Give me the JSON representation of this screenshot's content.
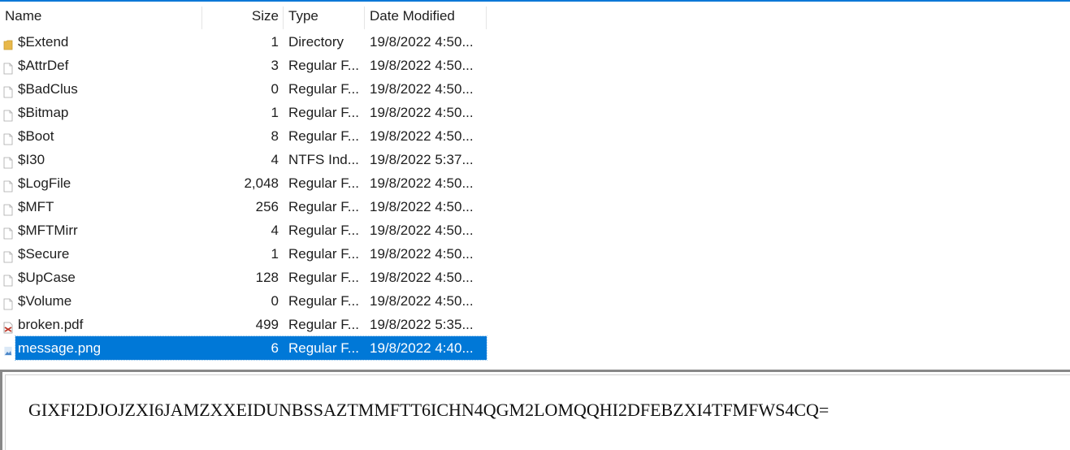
{
  "columns": {
    "name": "Name",
    "size": "Size",
    "type": "Type",
    "date": "Date Modified"
  },
  "files": [
    {
      "name": "$Extend",
      "size": "1",
      "type": "Directory",
      "date": "19/8/2022 4:50...",
      "icon": "folder-icon"
    },
    {
      "name": "$AttrDef",
      "size": "3",
      "type": "Regular F...",
      "date": "19/8/2022 4:50...",
      "icon": "file-icon"
    },
    {
      "name": "$BadClus",
      "size": "0",
      "type": "Regular F...",
      "date": "19/8/2022 4:50...",
      "icon": "file-icon"
    },
    {
      "name": "$Bitmap",
      "size": "1",
      "type": "Regular F...",
      "date": "19/8/2022 4:50...",
      "icon": "file-icon"
    },
    {
      "name": "$Boot",
      "size": "8",
      "type": "Regular F...",
      "date": "19/8/2022 4:50...",
      "icon": "file-icon"
    },
    {
      "name": "$I30",
      "size": "4",
      "type": "NTFS Ind...",
      "date": "19/8/2022 5:37...",
      "icon": "file-icon"
    },
    {
      "name": "$LogFile",
      "size": "2,048",
      "type": "Regular F...",
      "date": "19/8/2022 4:50...",
      "icon": "file-icon"
    },
    {
      "name": "$MFT",
      "size": "256",
      "type": "Regular F...",
      "date": "19/8/2022 4:50...",
      "icon": "file-icon"
    },
    {
      "name": "$MFTMirr",
      "size": "4",
      "type": "Regular F...",
      "date": "19/8/2022 4:50...",
      "icon": "file-icon"
    },
    {
      "name": "$Secure",
      "size": "1",
      "type": "Regular F...",
      "date": "19/8/2022 4:50...",
      "icon": "file-icon"
    },
    {
      "name": "$UpCase",
      "size": "128",
      "type": "Regular F...",
      "date": "19/8/2022 4:50...",
      "icon": "file-icon"
    },
    {
      "name": "$Volume",
      "size": "0",
      "type": "Regular F...",
      "date": "19/8/2022 4:50...",
      "icon": "file-icon"
    },
    {
      "name": "broken.pdf",
      "size": "499",
      "type": "Regular F...",
      "date": "19/8/2022 5:35...",
      "icon": "pdf-icon"
    },
    {
      "name": "message.png",
      "size": "6",
      "type": "Regular F...",
      "date": "19/8/2022 4:40...",
      "icon": "image-icon",
      "selected": true
    }
  ],
  "preview": {
    "text": "GIXFI2DJOJZXI6JAMZXXEIDUNBSSAZTMMFTT6ICHN4QGM2LOMQQHI2DFEBZXI4TFMFWS4CQ="
  },
  "colors": {
    "accent": "#0078d7",
    "folder": "#e8b84a",
    "pdf": "#c0392b"
  }
}
